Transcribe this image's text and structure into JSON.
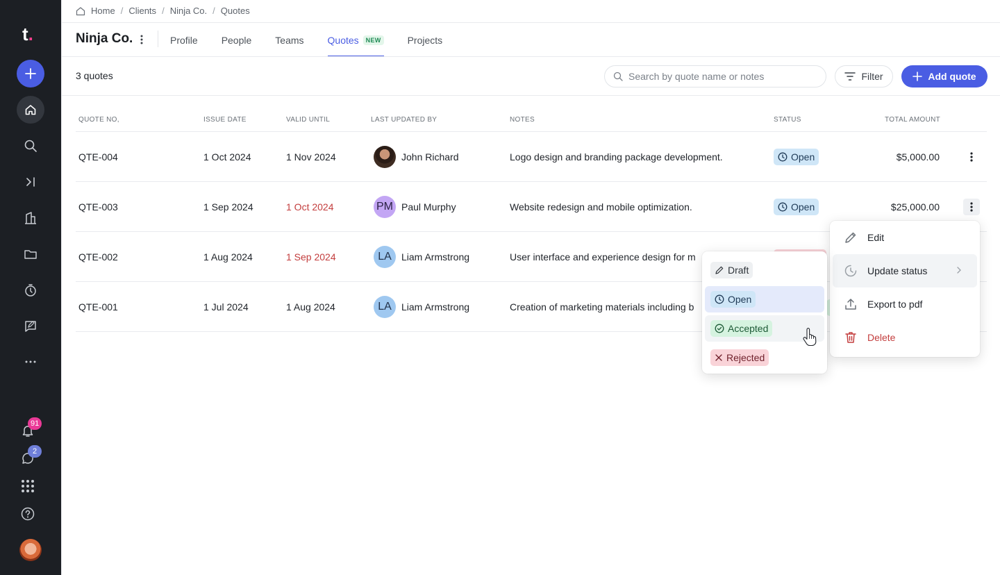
{
  "sidebar": {
    "logo": "t",
    "notifications_count": "91",
    "messages_count": "2",
    "icons": [
      "add-icon",
      "home-icon",
      "search-icon",
      "collapse-icon",
      "building-icon",
      "folder-icon",
      "timer-icon",
      "note-icon",
      "more-icon",
      "bell-icon",
      "chat-icon",
      "apps-icon",
      "help-icon"
    ]
  },
  "breadcrumb": [
    "Home",
    "Clients",
    "Ninja Co.",
    "Quotes"
  ],
  "header": {
    "title": "Ninja Co.",
    "tabs": [
      "Profile",
      "People",
      "Teams",
      "Quotes",
      "Projects"
    ],
    "active_tab": "Quotes",
    "new_badge": "NEW"
  },
  "toolbar": {
    "count": "3 quotes",
    "search_placeholder": "Search by quote name or notes",
    "filter_label": "Filter",
    "add_label": "Add quote"
  },
  "table": {
    "columns": [
      "QUOTE NO,",
      "ISSUE DATE",
      "VALID UNTIL",
      "LAST UPDATED BY",
      "NOTES",
      "STATUS",
      "TOTAL AMOUNT"
    ],
    "rows": [
      {
        "id": "QTE-004",
        "issue": "1 Oct 2024",
        "valid": "1 Nov 2024",
        "valid_overdue": false,
        "user": "John Richard",
        "avatar": "photo",
        "initials": "",
        "notes": "Logo design and branding package development.",
        "status": "Open",
        "amount": "$5,000.00"
      },
      {
        "id": "QTE-003",
        "issue": "1 Sep 2024",
        "valid": "1 Oct 2024",
        "valid_overdue": true,
        "user": "Paul Murphy",
        "avatar": "pm",
        "initials": "PM",
        "notes": "Website redesign and mobile optimization.",
        "status": "Open",
        "amount": "$25,000.00"
      },
      {
        "id": "QTE-002",
        "issue": "1 Aug 2024",
        "valid": "1 Sep 2024",
        "valid_overdue": true,
        "user": "Liam Armstrong",
        "avatar": "la",
        "initials": "LA",
        "notes": "User interface and experience design for m",
        "status": "",
        "amount": ""
      },
      {
        "id": "QTE-001",
        "issue": "1 Jul 2024",
        "valid": "1 Aug 2024",
        "valid_overdue": false,
        "user": "Liam Armstrong",
        "avatar": "la",
        "initials": "LA",
        "notes": "Creation of marketing materials including b",
        "status": "",
        "amount": ""
      }
    ]
  },
  "row_menu": {
    "items": [
      "Edit",
      "Update status",
      "Export to pdf",
      "Delete"
    ]
  },
  "status_menu": {
    "items": [
      "Draft",
      "Open",
      "Accepted",
      "Rejected"
    ],
    "selected": "Open",
    "hovered": "Accepted"
  },
  "colors": {
    "accent": "#4a5de3",
    "sidebar": "#1c1f24",
    "danger": "#c33d3d",
    "open_bg": "#cfe6f7",
    "accepted_bg": "#d6f3e0",
    "rejected_bg": "#f9d3d8"
  }
}
